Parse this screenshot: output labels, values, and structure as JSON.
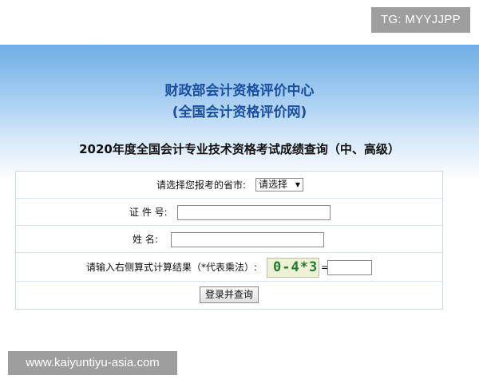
{
  "watermark_top": "TG: MYYJJPP",
  "watermark_bottom": "www.kaiyuntiyu-asia.com",
  "header": {
    "org_name": "财政部会计资格评价中心",
    "org_site": "(全国会计资格评价网)",
    "query_title": "2020年度全国会计专业技术资格考试成绩查询（中、高级）"
  },
  "form": {
    "province_label": "请选择您报考的省市:",
    "province_select_value": "请选择",
    "id_label": "证 件 号:",
    "id_value": "",
    "name_label": "姓  名:",
    "name_value": "",
    "captcha_label": "请输入右侧算式计算结果（*代表乘法）:",
    "captcha_text": "0-4*3",
    "equals": "=",
    "captcha_answer": "",
    "submit_label": "登录并查询"
  },
  "colors": {
    "title_blue": "#1a4fa0",
    "header_gradient_top": "#6eaee6",
    "table_border": "#c9dbe6",
    "watermark_bg": "#9e9e9e",
    "captcha_text": "#1f7a2e"
  }
}
